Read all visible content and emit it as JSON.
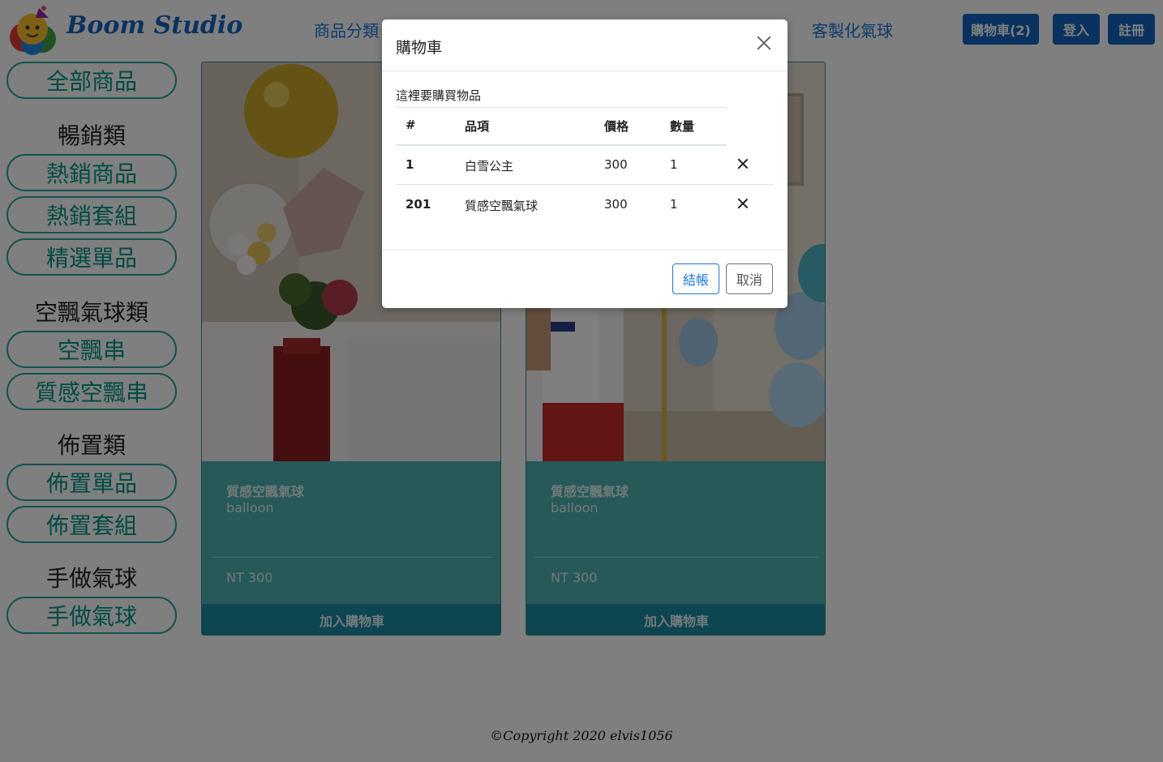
{
  "header": {
    "logo_text": "Boom Studio",
    "nav": {
      "categories": "商品分類",
      "custom": "客製化氣球"
    },
    "buttons": {
      "cart": "購物車(2)",
      "login": "登入",
      "register": "註冊"
    }
  },
  "sidebar": {
    "all": "全部商品",
    "groups": [
      {
        "heading": "暢銷類",
        "items": [
          "熱銷商品",
          "熱銷套組",
          "精選單品"
        ]
      },
      {
        "heading": "空飄氣球類",
        "items": [
          "空飄串",
          "質感空飄串"
        ]
      },
      {
        "heading": "佈置類",
        "items": [
          "佈置單品",
          "佈置套組"
        ]
      },
      {
        "heading": "手做氣球",
        "items": [
          "手做氣球"
        ]
      }
    ]
  },
  "cards": [
    {
      "title": "質感空飄氣球",
      "subtitle": "balloon",
      "price": "NT 300",
      "button": "加入購物車"
    },
    {
      "title": "質感空飄氣球",
      "subtitle": "balloon",
      "price": "NT 300",
      "button": "加入購物車"
    }
  ],
  "footer": {
    "text": "©Copyright 2020 elvis1056"
  },
  "modal": {
    "title": "購物車",
    "caption": "這裡要購買物品",
    "columns": {
      "num": "#",
      "item": "品項",
      "price": "價格",
      "qty": "數量"
    },
    "rows": [
      {
        "num": "1",
        "item": "白雪公主",
        "price": "300",
        "qty": "1"
      },
      {
        "num": "201",
        "item": "質感空飄氣球",
        "price": "300",
        "qty": "1"
      }
    ],
    "buttons": {
      "checkout": "結帳",
      "cancel": "取消"
    }
  },
  "colors": {
    "brand": "#1565c0",
    "accent": "#26a69a",
    "card": "#4fb3b3"
  }
}
